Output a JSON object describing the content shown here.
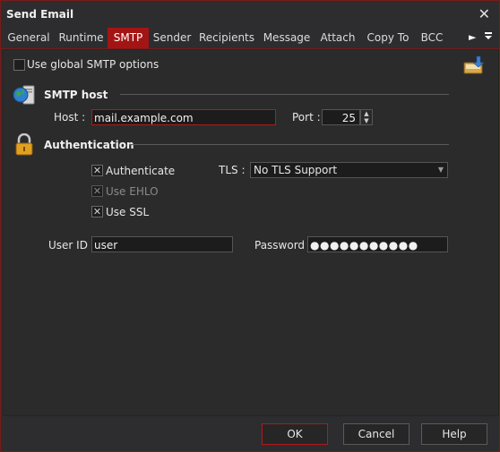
{
  "window": {
    "title": "Send Email"
  },
  "tabs": [
    {
      "label": "General"
    },
    {
      "label": "Runtime"
    },
    {
      "label": "SMTP"
    },
    {
      "label": "Sender"
    },
    {
      "label": "Recipients"
    },
    {
      "label": "Message"
    },
    {
      "label": "Attach"
    },
    {
      "label": "Copy To"
    },
    {
      "label": "BCC"
    }
  ],
  "active_tab": "SMTP",
  "global_smtp": {
    "label": "Use global SMTP options",
    "checked": false
  },
  "smtp_host": {
    "section": "SMTP host",
    "host_label": "Host :",
    "host_value": "mail.example.com",
    "port_label": "Port :",
    "port_value": "25"
  },
  "authentication": {
    "section": "Authentication",
    "authenticate": {
      "label": "Authenticate",
      "checked": true
    },
    "use_ehlo": {
      "label": "Use EHLO",
      "checked": true,
      "disabled": true
    },
    "use_ssl": {
      "label": "Use SSL",
      "checked": true
    },
    "tls_label": "TLS :",
    "tls_value": "No TLS Support"
  },
  "credentials": {
    "userid_label": "User ID :",
    "userid_value": "user",
    "password_label": "Password :",
    "password_value": "●●●●●●●●●●●"
  },
  "buttons": {
    "ok": "OK",
    "cancel": "Cancel",
    "help": "Help"
  },
  "colors": {
    "accent": "#a31515",
    "background": "#2b2b2b"
  },
  "icons": [
    "close-icon",
    "scroll-right-icon",
    "menu-dropdown-icon",
    "import-icon",
    "globe-server-icon",
    "padlock-icon"
  ]
}
